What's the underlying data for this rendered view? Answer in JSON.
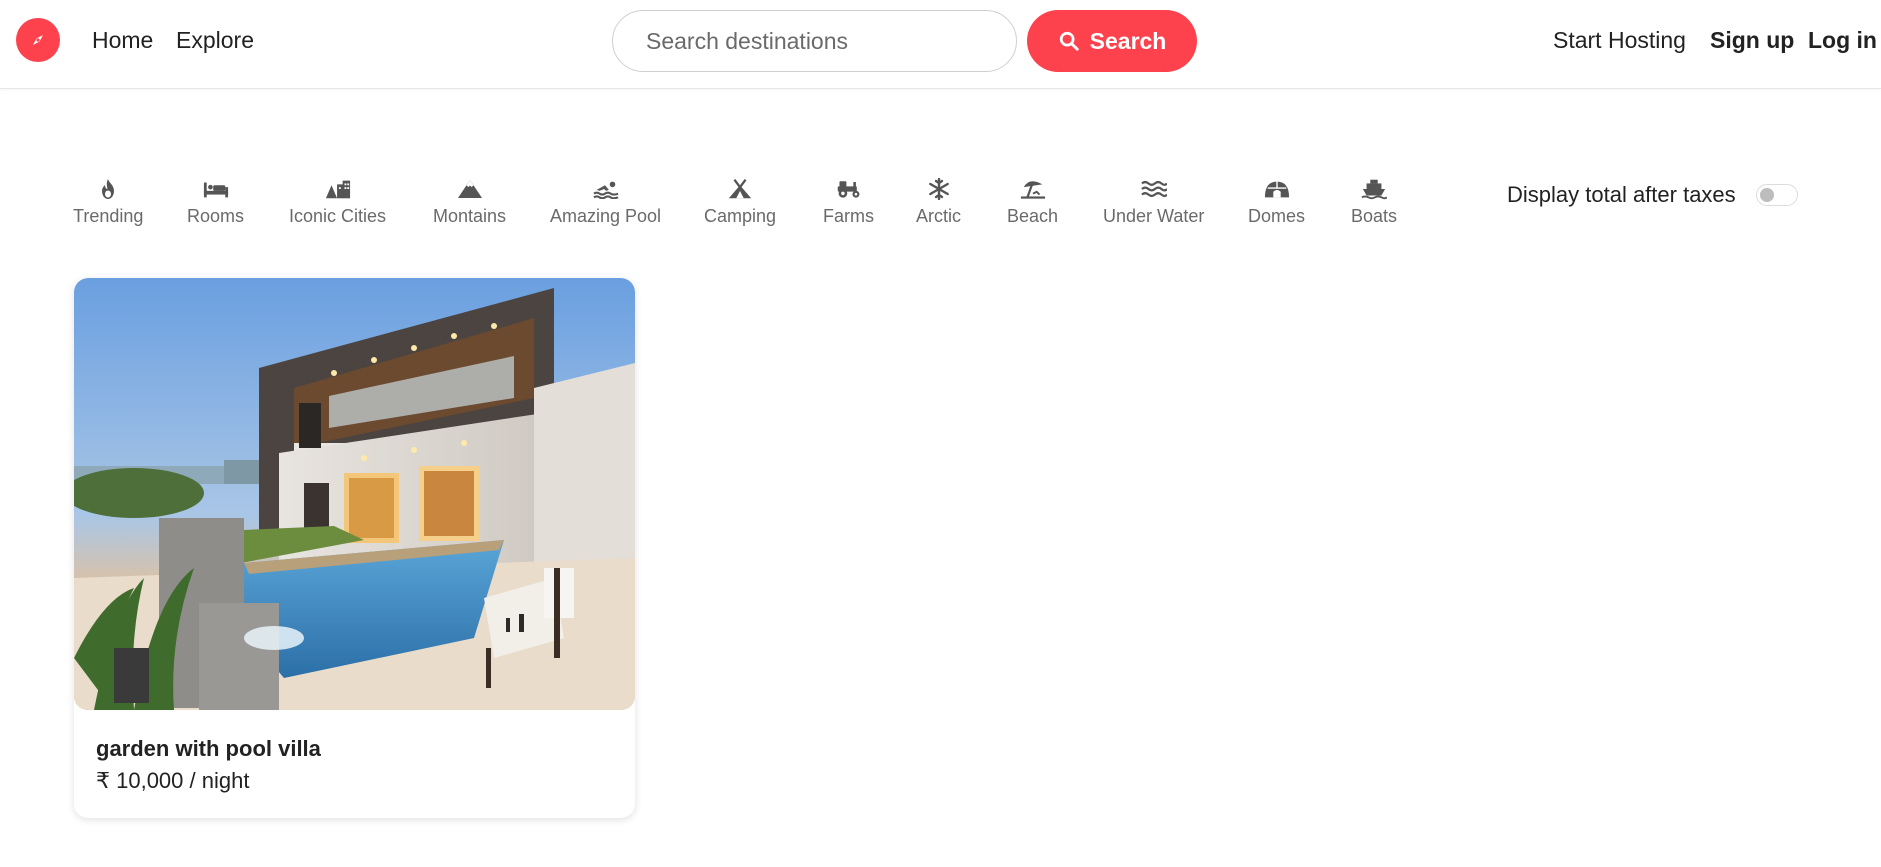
{
  "navbar": {
    "logo_icon": "compass-icon",
    "home_label": "Home",
    "explore_label": "Explore",
    "search_placeholder": "Search destinations",
    "search_button_label": "Search",
    "start_hosting_label": "Start Hosting",
    "signup_label": "Sign up",
    "login_label": "Log in"
  },
  "filters": [
    {
      "label": "Trending",
      "icon": "fire-icon"
    },
    {
      "label": "Rooms",
      "icon": "bed-icon"
    },
    {
      "label": "Iconic Cities",
      "icon": "city-icon"
    },
    {
      "label": "Montains",
      "icon": "mountain-icon"
    },
    {
      "label": "Amazing Pool",
      "icon": "swimmer-icon"
    },
    {
      "label": "Camping",
      "icon": "tent-icon"
    },
    {
      "label": "Farms",
      "icon": "tractor-icon"
    },
    {
      "label": "Arctic",
      "icon": "snowflake-icon"
    },
    {
      "label": "Beach",
      "icon": "umbrella-beach-icon"
    },
    {
      "label": "Under Water",
      "icon": "water-icon"
    },
    {
      "label": "Domes",
      "icon": "igloo-icon"
    },
    {
      "label": "Boats",
      "icon": "ship-icon"
    }
  ],
  "tax_toggle": {
    "label": "Display total after taxes",
    "enabled": false
  },
  "listings": [
    {
      "title": "garden with pool villa",
      "price": "₹ 10,000 / night"
    }
  ],
  "colors": {
    "brand": "#fe424d",
    "text": "#222222",
    "muted": "#6a6a6a"
  }
}
